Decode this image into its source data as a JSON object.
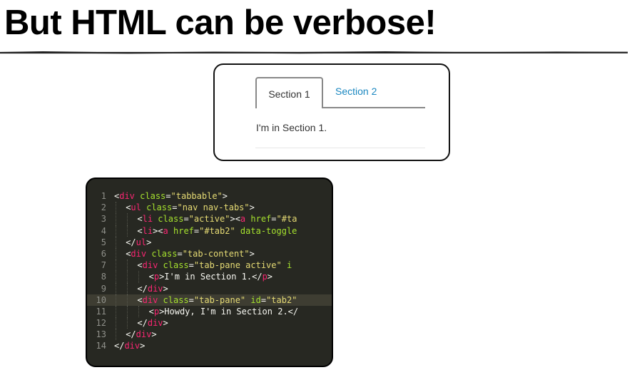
{
  "slide": {
    "title": "But HTML can be verbose!"
  },
  "demo": {
    "tabs": [
      {
        "label": "Section 1",
        "active": true
      },
      {
        "label": "Section 2",
        "active": false
      }
    ],
    "content_text": "I'm in Section 1.",
    "colors": {
      "link": "#1a87c0",
      "tab_border": "#888888"
    }
  },
  "editor": {
    "theme_colors": {
      "background": "#272822",
      "tag": "#f92672",
      "attr": "#a6e22e",
      "string": "#e6db74"
    },
    "highlighted_line": 10,
    "lines": [
      {
        "n": "1",
        "indent": 0,
        "tokens": [
          {
            "t": "<",
            "c": "txt"
          },
          {
            "t": "div",
            "c": "tag"
          },
          {
            "t": " class",
            "c": "attr"
          },
          {
            "t": "=",
            "c": "txt"
          },
          {
            "t": "\"tabbable\"",
            "c": "str"
          },
          {
            "t": ">",
            "c": "txt"
          }
        ]
      },
      {
        "n": "2",
        "indent": 1,
        "tokens": [
          {
            "t": "<",
            "c": "txt"
          },
          {
            "t": "ul",
            "c": "tag"
          },
          {
            "t": " class",
            "c": "attr"
          },
          {
            "t": "=",
            "c": "txt"
          },
          {
            "t": "\"nav nav-tabs\"",
            "c": "str"
          },
          {
            "t": ">",
            "c": "txt"
          }
        ]
      },
      {
        "n": "3",
        "indent": 2,
        "tokens": [
          {
            "t": "<",
            "c": "txt"
          },
          {
            "t": "li",
            "c": "tag"
          },
          {
            "t": " class",
            "c": "attr"
          },
          {
            "t": "=",
            "c": "txt"
          },
          {
            "t": "\"active\"",
            "c": "str"
          },
          {
            "t": "><",
            "c": "txt"
          },
          {
            "t": "a",
            "c": "tag"
          },
          {
            "t": " href",
            "c": "attr"
          },
          {
            "t": "=",
            "c": "txt"
          },
          {
            "t": "\"#ta",
            "c": "str"
          }
        ]
      },
      {
        "n": "4",
        "indent": 2,
        "tokens": [
          {
            "t": "<",
            "c": "txt"
          },
          {
            "t": "li",
            "c": "tag"
          },
          {
            "t": "><",
            "c": "txt"
          },
          {
            "t": "a",
            "c": "tag"
          },
          {
            "t": " href",
            "c": "attr"
          },
          {
            "t": "=",
            "c": "txt"
          },
          {
            "t": "\"#tab2\"",
            "c": "str"
          },
          {
            "t": " data-toggle",
            "c": "attr"
          }
        ]
      },
      {
        "n": "5",
        "indent": 1,
        "tokens": [
          {
            "t": "</",
            "c": "txt"
          },
          {
            "t": "ul",
            "c": "tag"
          },
          {
            "t": ">",
            "c": "txt"
          }
        ]
      },
      {
        "n": "6",
        "indent": 1,
        "tokens": [
          {
            "t": "<",
            "c": "txt"
          },
          {
            "t": "div",
            "c": "tag"
          },
          {
            "t": " class",
            "c": "attr"
          },
          {
            "t": "=",
            "c": "txt"
          },
          {
            "t": "\"tab-content\"",
            "c": "str"
          },
          {
            "t": ">",
            "c": "txt"
          }
        ]
      },
      {
        "n": "7",
        "indent": 2,
        "tokens": [
          {
            "t": "<",
            "c": "txt"
          },
          {
            "t": "div",
            "c": "tag"
          },
          {
            "t": " class",
            "c": "attr"
          },
          {
            "t": "=",
            "c": "txt"
          },
          {
            "t": "\"tab-pane active\"",
            "c": "str"
          },
          {
            "t": " i",
            "c": "attr"
          }
        ]
      },
      {
        "n": "8",
        "indent": 3,
        "tokens": [
          {
            "t": "<",
            "c": "txt"
          },
          {
            "t": "p",
            "c": "tag"
          },
          {
            "t": ">I'm in Section 1.</",
            "c": "txt"
          },
          {
            "t": "p",
            "c": "tag"
          },
          {
            "t": ">",
            "c": "txt"
          }
        ]
      },
      {
        "n": "9",
        "indent": 2,
        "tokens": [
          {
            "t": "</",
            "c": "txt"
          },
          {
            "t": "div",
            "c": "tag"
          },
          {
            "t": ">",
            "c": "txt"
          }
        ]
      },
      {
        "n": "10",
        "indent": 2,
        "tokens": [
          {
            "t": "<",
            "c": "txt"
          },
          {
            "t": "div",
            "c": "tag"
          },
          {
            "t": " class",
            "c": "attr"
          },
          {
            "t": "=",
            "c": "txt"
          },
          {
            "t": "\"tab-pane\"",
            "c": "str"
          },
          {
            "t": " id",
            "c": "attr"
          },
          {
            "t": "=",
            "c": "txt"
          },
          {
            "t": "\"tab2\"",
            "c": "str"
          }
        ]
      },
      {
        "n": "11",
        "indent": 3,
        "tokens": [
          {
            "t": "<",
            "c": "txt"
          },
          {
            "t": "p",
            "c": "tag"
          },
          {
            "t": ">Howdy, I'm in Section 2.</",
            "c": "txt"
          }
        ]
      },
      {
        "n": "12",
        "indent": 2,
        "tokens": [
          {
            "t": "</",
            "c": "txt"
          },
          {
            "t": "div",
            "c": "tag"
          },
          {
            "t": ">",
            "c": "txt"
          }
        ]
      },
      {
        "n": "13",
        "indent": 1,
        "tokens": [
          {
            "t": "</",
            "c": "txt"
          },
          {
            "t": "div",
            "c": "tag"
          },
          {
            "t": ">",
            "c": "txt"
          }
        ]
      },
      {
        "n": "14",
        "indent": 0,
        "tokens": [
          {
            "t": "</",
            "c": "txt"
          },
          {
            "t": "div",
            "c": "tag"
          },
          {
            "t": ">",
            "c": "txt"
          }
        ]
      }
    ]
  }
}
